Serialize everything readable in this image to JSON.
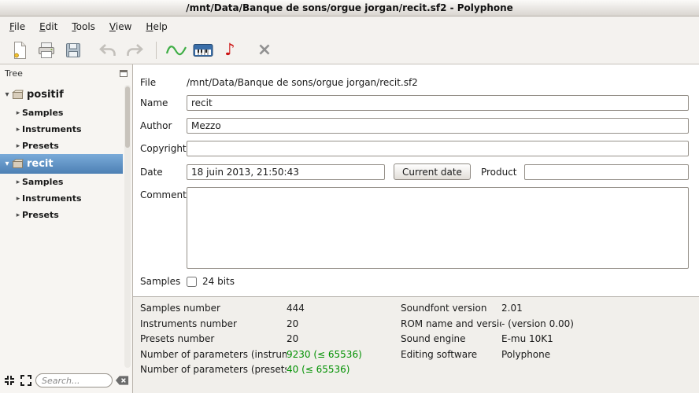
{
  "window": {
    "title": "/mnt/Data/Banque de sons/orgue jorgan/recit.sf2 - Polyphone"
  },
  "menu": {
    "items": [
      "File",
      "Edit",
      "Tools",
      "View",
      "Help"
    ]
  },
  "toolbar": {
    "icons": [
      "new-file",
      "print",
      "save",
      "undo",
      "redo",
      "sine-wave",
      "virtual-keyboard",
      "recorder-note",
      "close-file"
    ]
  },
  "sidebar": {
    "panel_title": "Tree",
    "search_placeholder": "Search...",
    "items": [
      {
        "label": "positif",
        "selected": false,
        "children": [
          "Samples",
          "Instruments",
          "Presets"
        ]
      },
      {
        "label": "recit",
        "selected": true,
        "children": [
          "Samples",
          "Instruments",
          "Presets"
        ]
      }
    ]
  },
  "form": {
    "file_label": "File",
    "file_value": "/mnt/Data/Banque de sons/orgue jorgan/recit.sf2",
    "name_label": "Name",
    "name_value": "recit",
    "author_label": "Author",
    "author_value": "Mezzo",
    "copyright_label": "Copyright",
    "copyright_value": "",
    "date_label": "Date",
    "date_value": "18 juin 2013, 21:50:43",
    "current_date_button": "Current date",
    "product_label": "Product",
    "product_value": "",
    "comments_label": "Comments",
    "comments_value": "",
    "samples_label": "Samples",
    "bits_checkbox_label": "24 bits"
  },
  "summary": {
    "left": [
      {
        "label": "Samples number",
        "value": "444"
      },
      {
        "label": "Instruments number",
        "value": "20"
      },
      {
        "label": "Presets number",
        "value": "20"
      },
      {
        "label": "Number of parameters (instruments)",
        "value": "9230 (≤ 65536)"
      },
      {
        "label": "Number of parameters (presets)",
        "value": "40 (≤ 65536)"
      }
    ],
    "right": [
      {
        "label": "Soundfont version",
        "value": "2.01"
      },
      {
        "label": "ROM name and version",
        "value": "- (version 0.00)"
      },
      {
        "label": "Sound engine",
        "value": "E-mu 10K1"
      },
      {
        "label": "Editing software",
        "value": "Polyphone"
      }
    ]
  },
  "colors": {
    "selection_blue": "#4d80b4",
    "ok_green": "#009000",
    "note_red": "#cc1414",
    "sine_green": "#3fae46"
  }
}
